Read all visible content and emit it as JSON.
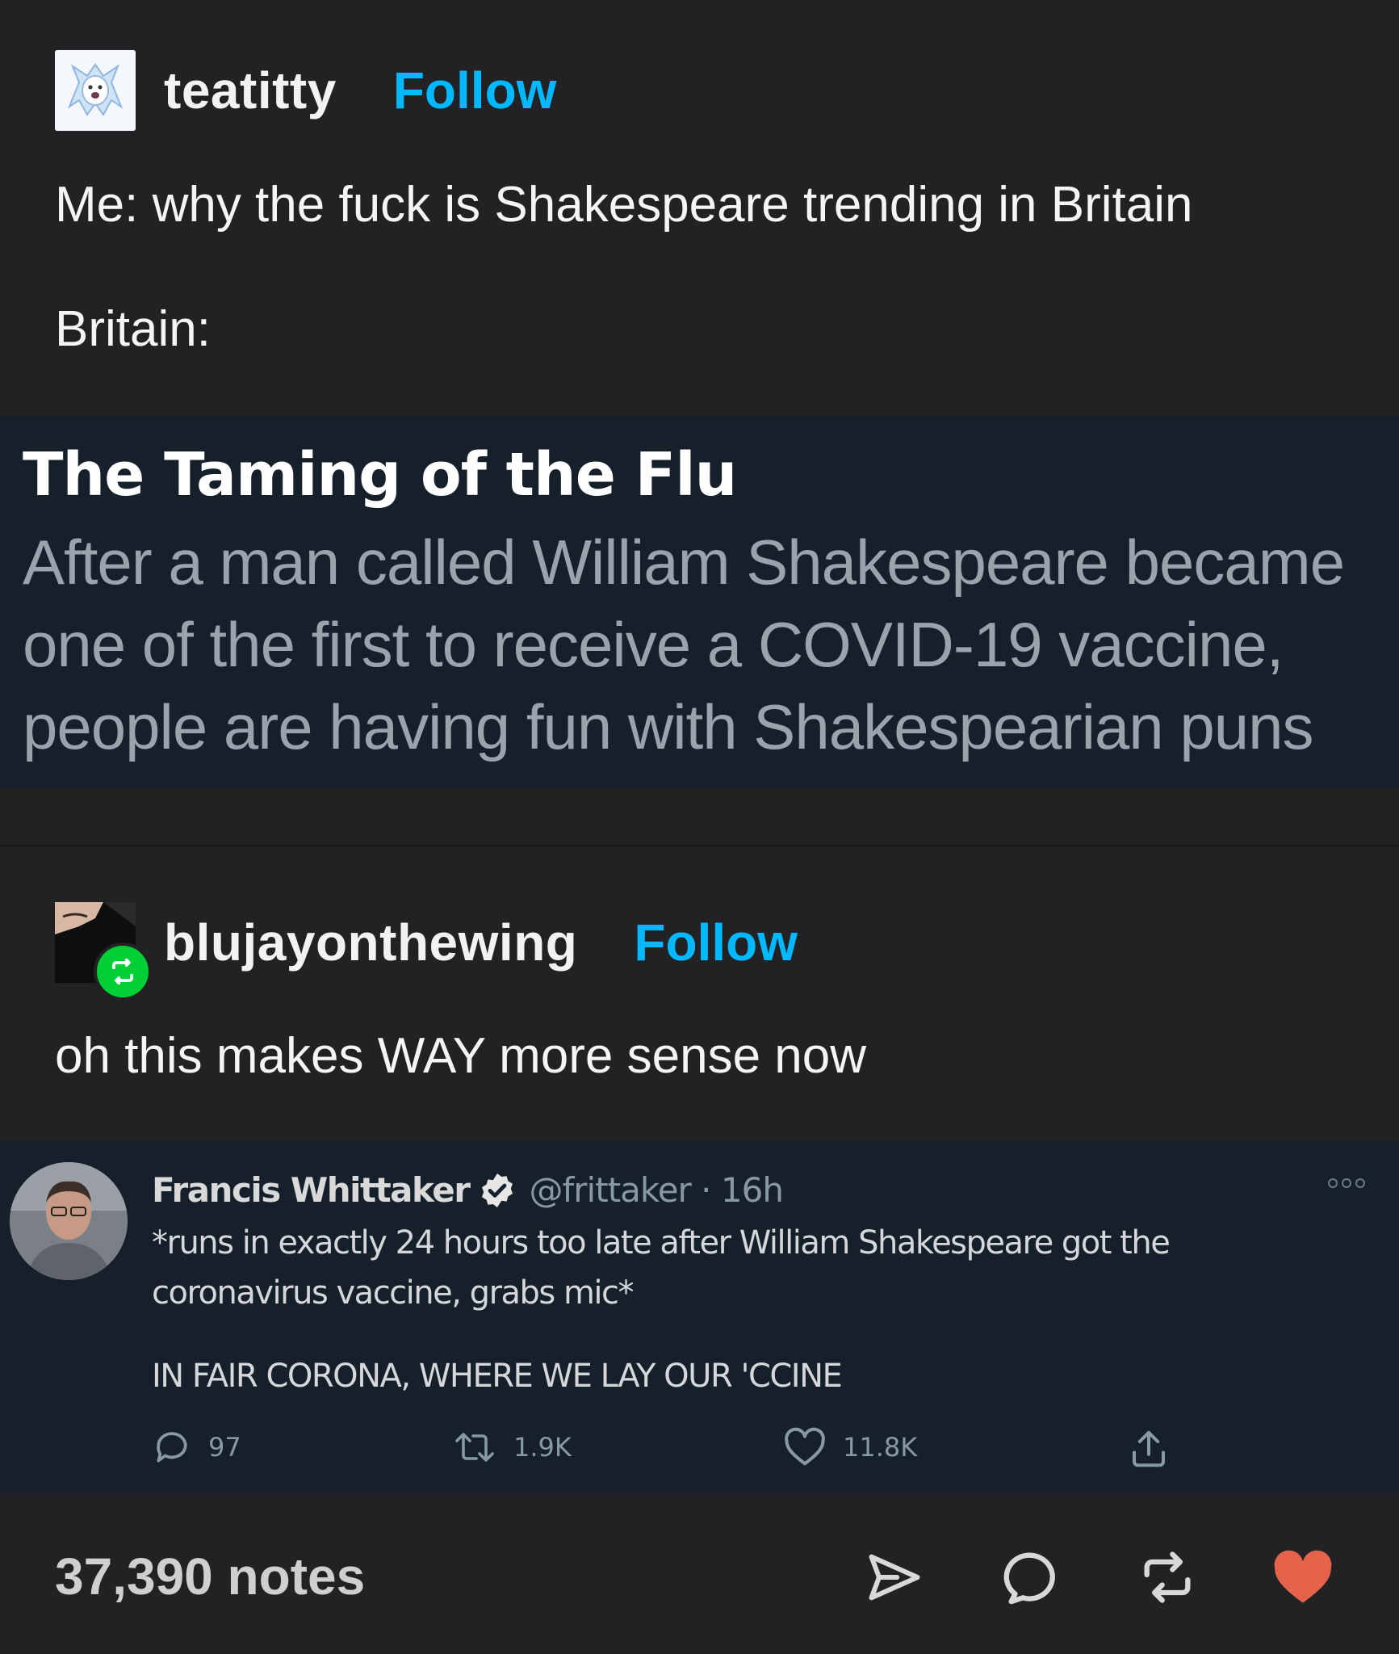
{
  "post1": {
    "username": "teatitty",
    "follow_label": "Follow",
    "text_line1": "Me: why the fuck is Shakespeare trending in Britain",
    "text_line2": "Britain:"
  },
  "article": {
    "title": "The Taming of the Flu",
    "summary": "After a man called William Shakespeare became one of the first to receive a COVID-19 vaccine, people are having fun with Shakespearian puns"
  },
  "post2": {
    "username": "blujayonthewing",
    "follow_label": "Follow",
    "text": "oh this makes WAY more sense now"
  },
  "tweet": {
    "name": "Francis Whittaker",
    "handle_time": "@frittaker · 16h",
    "text1": "*runs in exactly 24 hours too late after William Shakespeare got the coronavirus vaccine, grabs mic*",
    "text2": "IN FAIR CORONA, WHERE WE LAY OUR 'CCINE",
    "replies": "97",
    "retweets": "1.9K",
    "likes": "11.8K"
  },
  "footer": {
    "notes": "37,390 notes"
  },
  "colors": {
    "background": "#222224",
    "follow_accent": "#00b8ff",
    "like_heart": "#e4634a",
    "reblog_badge": "#00cf35",
    "card_bg": "#15202b"
  },
  "icons": [
    "share-icon",
    "reply-icon",
    "reblog-icon",
    "like-icon",
    "verified-icon",
    "tweet-reply-icon",
    "tweet-retweet-icon",
    "tweet-like-icon",
    "tweet-share-icon",
    "more-icon"
  ]
}
